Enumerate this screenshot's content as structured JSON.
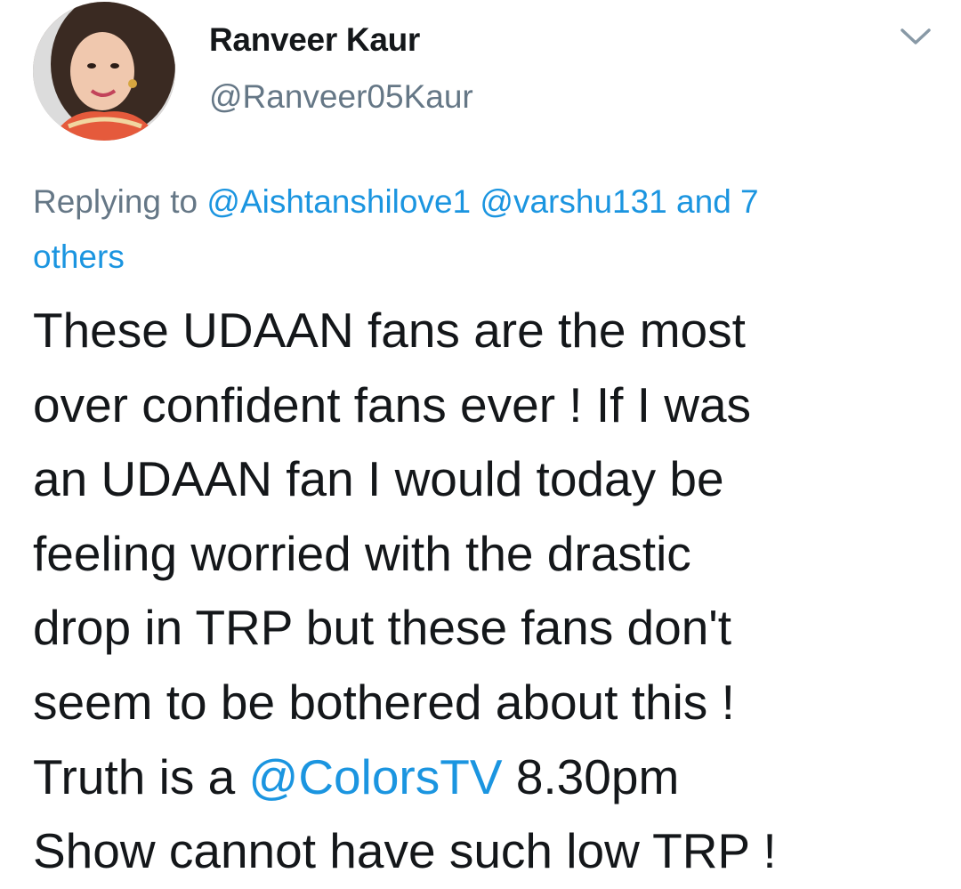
{
  "author": {
    "display_name": "Ranveer Kaur",
    "handle": "@Ranveer05Kaur",
    "avatar_icon": "profile-photo-avatar"
  },
  "menu": {
    "icon": "chevron-down-icon"
  },
  "reply": {
    "prefix": "Replying to",
    "mention_1": "@Aishtanshilove1",
    "mention_2": "@varshu131",
    "others_line1": "and 7",
    "others_line2": "others"
  },
  "tweet": {
    "line_1": "These UDAAN fans are the most",
    "line_2": "over confident fans ever ! If I was",
    "line_3": "an UDAAN fan I would today be",
    "line_4": "feeling worried with the drastic",
    "line_5": "drop in TRP but these fans don't",
    "line_6": "seem to be bothered about this !",
    "line_7_prefix": "Truth is a",
    "line_7_mention": "@ColorsTV",
    "line_7_suffix": "8.30pm",
    "line_8": "Show cannot have such low TRP !"
  },
  "colors": {
    "text": "#14171a",
    "secondary": "#657786",
    "link": "#1b95e0",
    "background": "#ffffff"
  }
}
